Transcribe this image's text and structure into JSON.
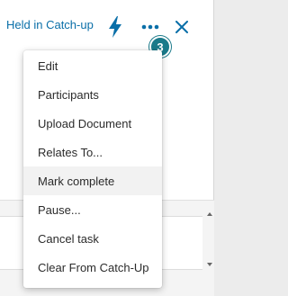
{
  "header": {
    "title": "Held in Catch-up",
    "lightning_icon": "lightning-bolt-icon",
    "more_icon": "more-horizontal-icon",
    "close_icon": "close-icon",
    "badge_count": "3",
    "accent_color": "#0a6fa8",
    "badge_color": "#1a7a8a"
  },
  "menu": {
    "items": [
      {
        "label": "Edit"
      },
      {
        "label": "Participants"
      },
      {
        "label": "Upload Document"
      },
      {
        "label": "Relates To..."
      },
      {
        "label": "Mark complete",
        "highlighted": true
      },
      {
        "label": "Pause..."
      },
      {
        "label": "Cancel task"
      },
      {
        "label": "Clear From Catch-Up"
      }
    ]
  }
}
